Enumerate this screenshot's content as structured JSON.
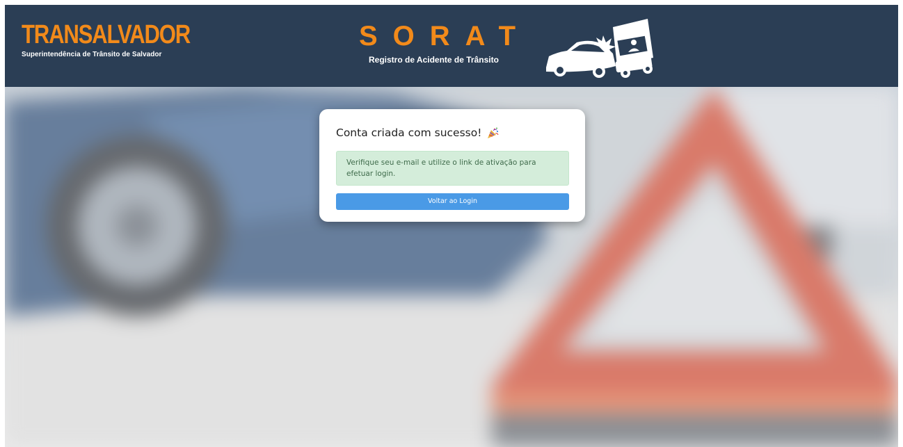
{
  "header": {
    "brand_name": "TRANSALVADOR",
    "brand_subtitle": "Superintendência de Trânsito de Salvador",
    "app_title": "SORAT",
    "app_subtitle": "Registro de Acidente de Trânsito",
    "illustration_icon": "car-crash-icon"
  },
  "card": {
    "title": "Conta criada com sucesso!",
    "title_icon": "party-popper-icon",
    "message": "Verifique seu e-mail e utilize o link de ativação para efetuar login.",
    "back_button_label": "Voltar ao Login"
  },
  "colors": {
    "header_bg": "#2b3e55",
    "brand_orange": "#f28a1a",
    "alert_bg": "#d4edda",
    "alert_text": "#3f6b4b",
    "button_bg": "#4a9ae6"
  }
}
